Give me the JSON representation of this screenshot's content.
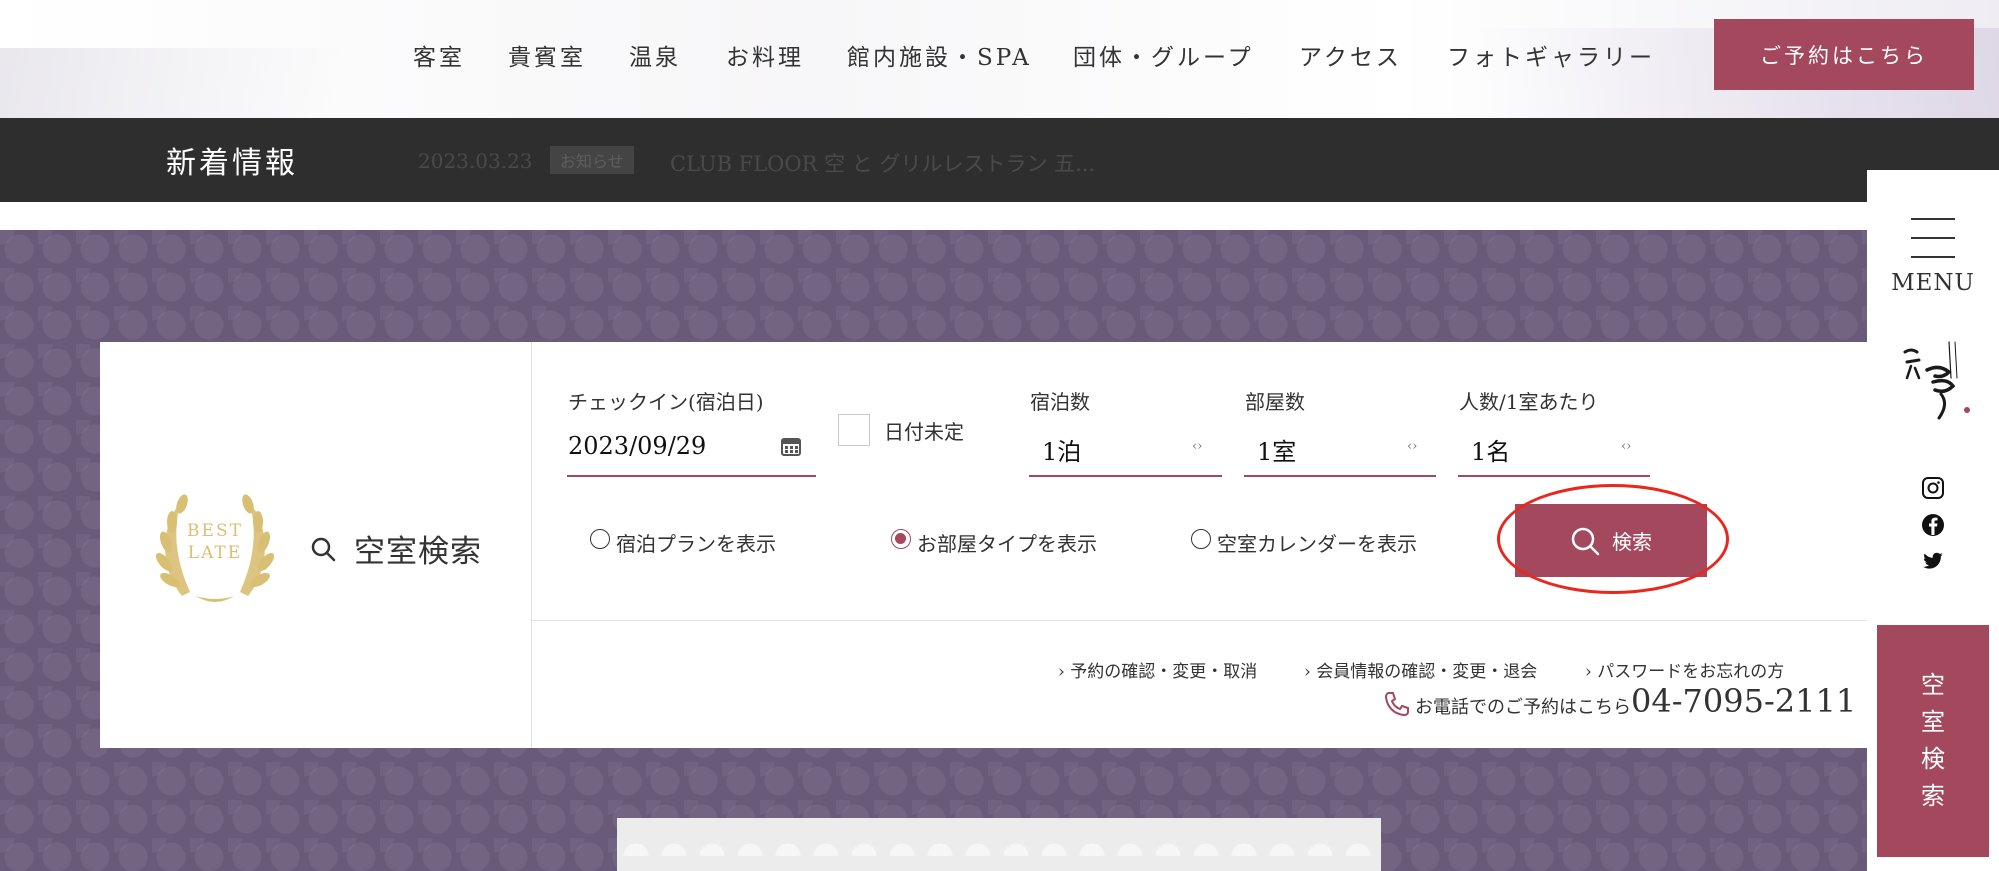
{
  "nav": {
    "items": [
      "客室",
      "貴賓室",
      "温泉",
      "お料理",
      "館内施設・SPA",
      "団体・グループ",
      "アクセス",
      "フォトギャラリー"
    ],
    "reserve_label": "ご予約はこちら"
  },
  "news": {
    "title": "新着情報",
    "date": "2023.03.23",
    "tag": "お知らせ",
    "text": "CLUB FLOOR 空 と グリルレストラン 五..."
  },
  "search": {
    "heading": "空室検索",
    "badge": [
      "BEST",
      "LATE"
    ],
    "checkin_label": "チェックイン(宿泊日)",
    "checkin_value": "2023/09/29",
    "undecided_label": "日付未定",
    "nights_label": "宿泊数",
    "nights_value": "1泊",
    "rooms_label": "部屋数",
    "rooms_value": "1室",
    "people_label": "人数/1室あたり",
    "people_value": "1名",
    "radio_options": [
      {
        "label": "宿泊プランを表示",
        "checked": false
      },
      {
        "label": "お部屋タイプを表示",
        "checked": true
      },
      {
        "label": "空室カレンダーを表示",
        "checked": false
      }
    ],
    "search_button": "検索",
    "links": [
      "予約の確認・変更・取消",
      "会員情報の確認・変更・退会",
      "パスワードをお忘れの方"
    ],
    "phone_text": "お電話でのご予約はこちら",
    "phone_number": "04-7095-2111"
  },
  "sidebar": {
    "menu_label": "MENU",
    "vacancy_chars": [
      "空",
      "室",
      "検",
      "索"
    ]
  },
  "colors": {
    "accent": "#a4485e",
    "purple_bg": "#6a5a7a",
    "dark_bar": "#2e2e2e",
    "highlight": "#e8281e",
    "gold": "#d9bf73"
  }
}
